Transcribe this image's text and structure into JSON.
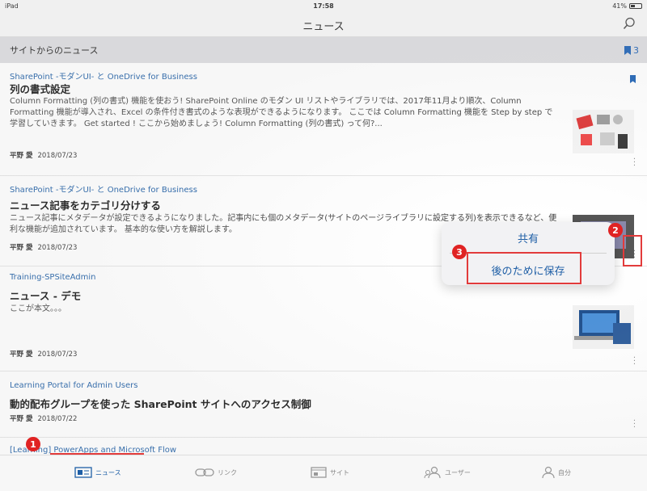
{
  "status": {
    "device": "iPad",
    "time": "17:58",
    "battery_text": "41%",
    "battery_level": 0.41
  },
  "nav": {
    "title": "ニュース"
  },
  "section": {
    "title": "サイトからのニュース",
    "bookmark_count": "3"
  },
  "items": [
    {
      "site": "SharePoint -モダンUI- と OneDrive for Business",
      "title": "列の書式設定",
      "body": "Column Formatting (列の書式) 機能を使おう! SharePoint Online のモダン UI リストやライブラリでは、2017年11月より順次、Column Formatting 機能が導入され、Excel の条件付き書式のような表現ができるようになります。 ここでは Column Formatting 機能を Step by step で学習していきます。 Get started ! ここから始めましょう! Column Formatting (列の書式) って何?...",
      "author": "平野 愛",
      "date": "2018/07/23"
    },
    {
      "site": "SharePoint -モダンUI- と OneDrive for Business",
      "title": "ニュース記事をカテゴリ分けする",
      "body": "ニュース記事にメタデータが設定できるようになりました。記事内にも個のメタデータ(サイトのページライブラリに設定する列)を表示できるなど、便利な機能が追加されています。 基本的な使い方を解説します。",
      "author": "平野 愛",
      "date": "2018/07/23"
    },
    {
      "site": "Training-SPSiteAdmin",
      "title": "ニュース - デモ",
      "body": "ここが本文。。。",
      "author": "平野 愛",
      "date": "2018/07/23"
    },
    {
      "site": "Learning Portal for Admin Users",
      "title": "動的配布グループを使った SharePoint サイトへのアクセス制御",
      "body": "",
      "author": "平野 愛",
      "date": "2018/07/22"
    },
    {
      "site": "[Learning] PowerApps and Microsoft Flow",
      "title": "",
      "body": "",
      "author": "",
      "date": ""
    }
  ],
  "popup": {
    "share": "共有",
    "save_for_later": "後のために保存"
  },
  "annotations": {
    "badge1": "1",
    "badge2": "2",
    "badge3": "3"
  },
  "tabs": [
    {
      "label": "ニュース",
      "icon": "news-icon"
    },
    {
      "label": "リンク",
      "icon": "link-icon"
    },
    {
      "label": "サイト",
      "icon": "site-icon"
    },
    {
      "label": "ユーザー",
      "icon": "users-icon"
    },
    {
      "label": "自分",
      "icon": "person-icon"
    }
  ],
  "colors": {
    "accent": "#1f5fa6",
    "highlight": "#e23b3b"
  }
}
